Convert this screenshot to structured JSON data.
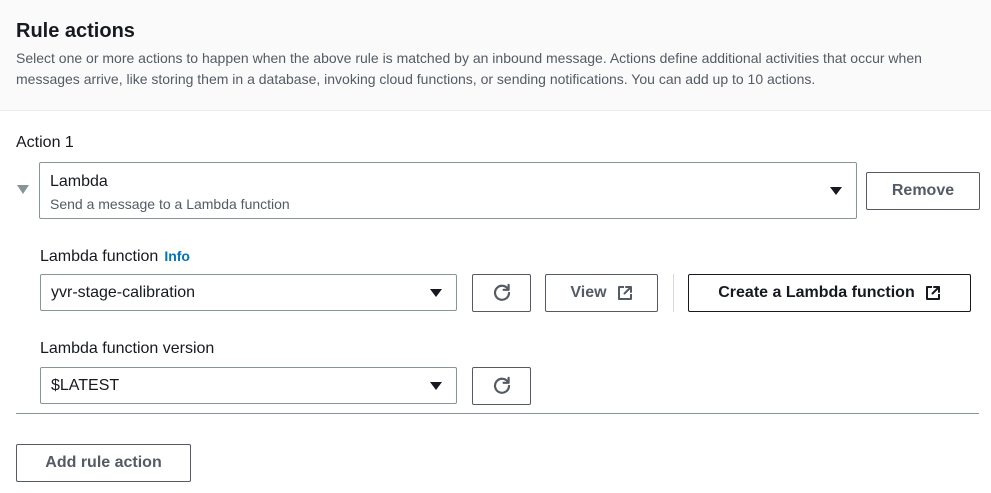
{
  "header": {
    "title": "Rule actions",
    "description": "Select one or more actions to happen when the above rule is matched by an inbound message. Actions define additional activities that occur when messages arrive, like storing them in a database, invoking cloud functions, or sending notifications. You can add up to 10 actions."
  },
  "action": {
    "label": "Action 1",
    "type_selected": "Lambda",
    "type_description": "Send a message to a Lambda function",
    "remove_label": "Remove"
  },
  "lambda_function": {
    "label": "Lambda function",
    "info_label": "Info",
    "selected": "yvr-stage-calibration",
    "view_label": "View",
    "create_label": "Create a Lambda function"
  },
  "lambda_version": {
    "label": "Lambda function version",
    "selected": "$LATEST"
  },
  "footer": {
    "add_label": "Add rule action"
  },
  "colors": {
    "header_bg": "#fafafa",
    "text_primary": "#16191f",
    "text_secondary": "#545b64",
    "border": "#879596",
    "link": "#0073bb"
  }
}
